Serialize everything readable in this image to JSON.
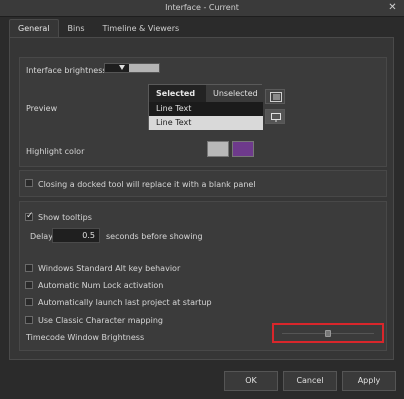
{
  "window": {
    "title": "Interface - Current",
    "close_icon": "close-icon"
  },
  "tabs": [
    {
      "label": "General",
      "active": true
    },
    {
      "label": "Bins",
      "active": false
    },
    {
      "label": "Timeline & Viewers",
      "active": false
    }
  ],
  "appearance": {
    "brightness_label": "Interface brightness",
    "preview_label": "Preview",
    "preview": {
      "selected_header": "Selected",
      "unselected_header": "Unselected",
      "rows": [
        "Line Text",
        "Line Text"
      ]
    },
    "highlight_label": "Highlight color",
    "highlight_colors": [
      "#b8b8b8",
      "#6e3a8c"
    ]
  },
  "docked": {
    "label": "Closing a docked tool will replace it with a blank panel",
    "checked": false
  },
  "options": {
    "tooltips_label": "Show tooltips",
    "tooltips_checked": true,
    "delay_label": "Delay",
    "delay_value": "0.5",
    "delay_suffix": "seconds before showing",
    "alt_key_label": "Windows Standard Alt key behavior",
    "numlock_label": "Automatic Num Lock activation",
    "launch_label": "Automatically launch last project at startup",
    "classic_char_label": "Use Classic Character mapping",
    "timecode_label": "Timecode Window Brightness",
    "timecode_brightness": 0.5
  },
  "buttons": {
    "ok": "OK",
    "cancel": "Cancel",
    "apply": "Apply"
  }
}
